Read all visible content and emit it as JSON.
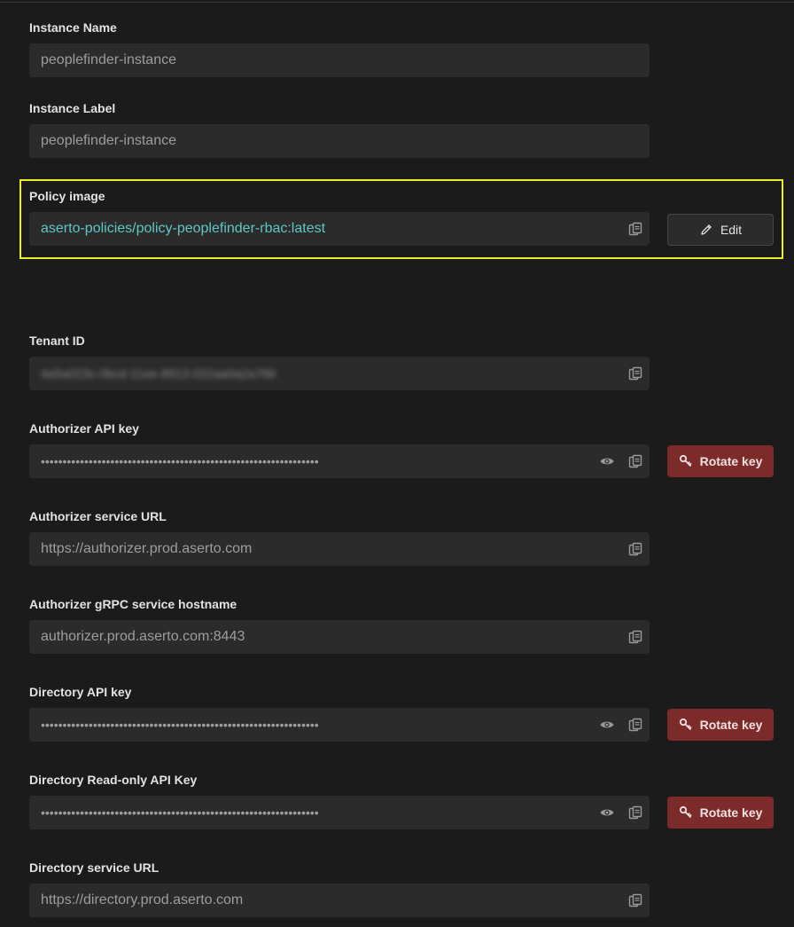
{
  "instance_name": {
    "label": "Instance Name",
    "value": "peoplefinder-instance"
  },
  "instance_label": {
    "label": "Instance Label",
    "value": "peoplefinder-instance"
  },
  "policy_image": {
    "label": "Policy image",
    "value": "aserto-policies/policy-peoplefinder-rbac:latest",
    "edit_label": "Edit",
    "highlight_color": "#e9ef2d",
    "link_color": "#5ec7c4"
  },
  "tenant_id": {
    "label": "Tenant ID",
    "value": "4a5a023c-0bcd-11ee-8913-022aa0a2a766"
  },
  "authorizer_api_key": {
    "label": "Authorizer API key",
    "value": "••••••••••••••••••••••••••••••••••••••••••••••••••••••••••••••••",
    "rotate_label": "Rotate key"
  },
  "authorizer_url": {
    "label": "Authorizer service URL",
    "value": "https://authorizer.prod.aserto.com"
  },
  "authorizer_grpc": {
    "label": "Authorizer gRPC service hostname",
    "value": "authorizer.prod.aserto.com:8443"
  },
  "directory_api_key": {
    "label": "Directory API key",
    "value": "••••••••••••••••••••••••••••••••••••••••••••••••••••••••••••••••",
    "rotate_label": "Rotate key"
  },
  "directory_ro_key": {
    "label": "Directory Read-only API Key",
    "value": "••••••••••••••••••••••••••••••••••••••••••••••••••••••••••••••••",
    "rotate_label": "Rotate key"
  },
  "directory_url": {
    "label": "Directory service URL",
    "value": "https://directory.prod.aserto.com"
  },
  "icons": {
    "copy": "copy-icon",
    "eye": "eye-icon",
    "pencil": "pencil-icon",
    "key": "key-icon"
  },
  "colors": {
    "background": "#1b1b1b",
    "input": "#2b2b2b",
    "rotate_button": "#7d2a2a"
  }
}
